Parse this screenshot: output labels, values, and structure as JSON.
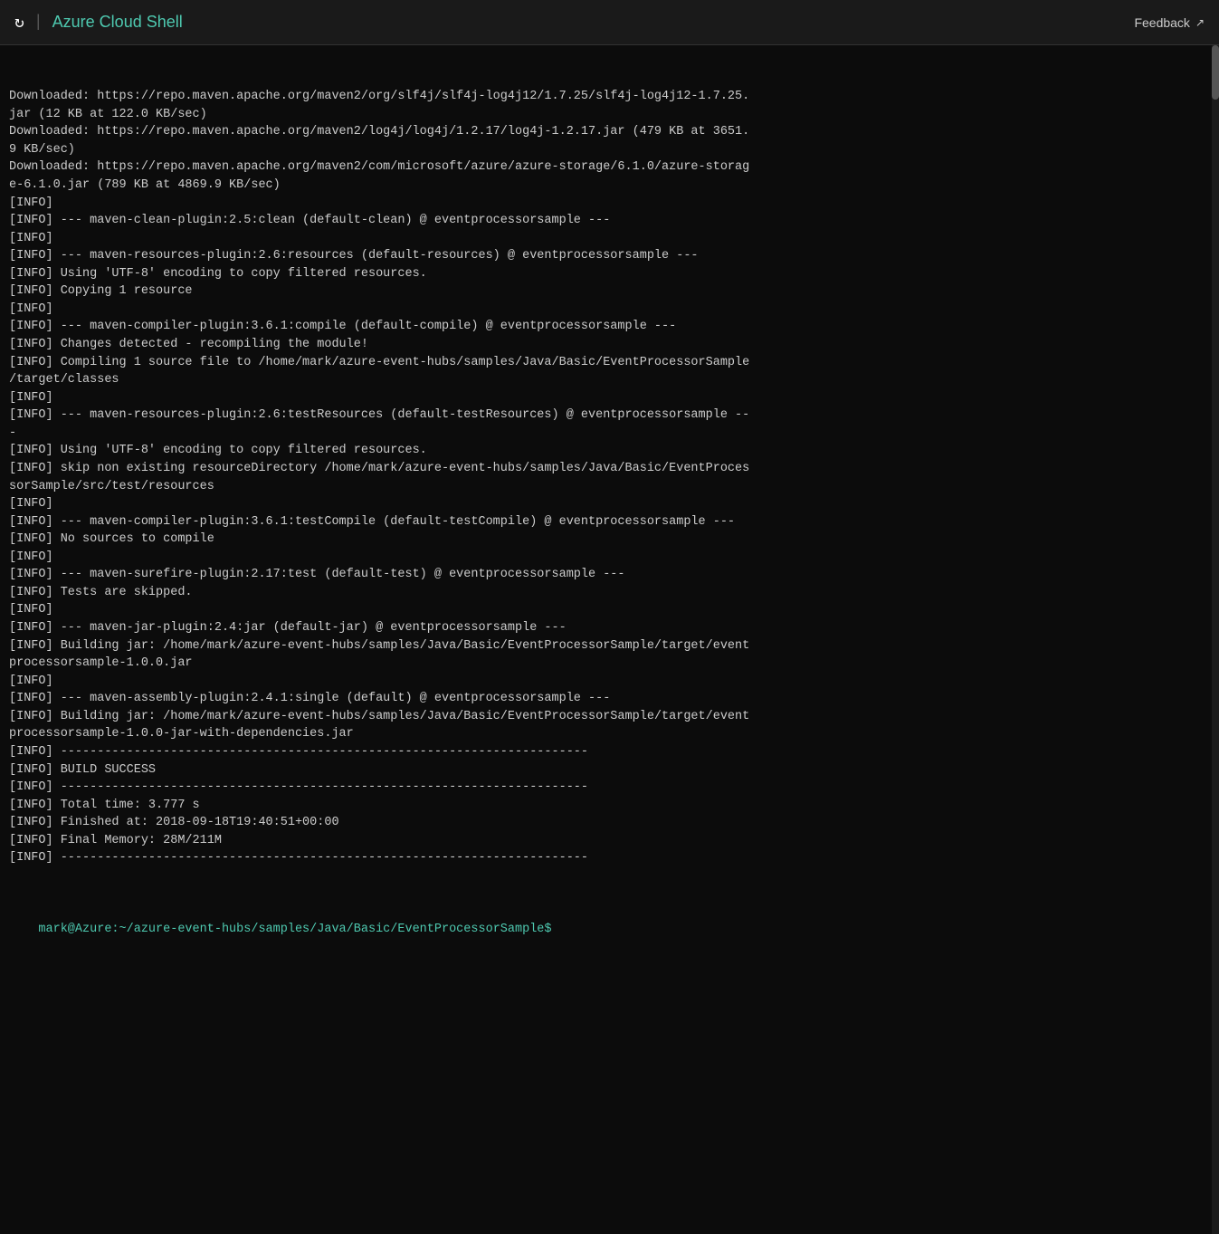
{
  "titleBar": {
    "appName": "Azure Cloud Shell",
    "feedbackLabel": "Feedback",
    "refreshIcon": "↻",
    "divider": "|",
    "externalLinkIcon": "↗"
  },
  "terminal": {
    "lines": [
      "Downloaded: https://repo.maven.apache.org/maven2/org/slf4j/slf4j-log4j12/1.7.25/slf4j-log4j12-1.7.25.",
      "jar (12 KB at 122.0 KB/sec)",
      "Downloaded: https://repo.maven.apache.org/maven2/log4j/log4j/1.2.17/log4j-1.2.17.jar (479 KB at 3651.",
      "9 KB/sec)",
      "Downloaded: https://repo.maven.apache.org/maven2/com/microsoft/azure/azure-storage/6.1.0/azure-storag",
      "e-6.1.0.jar (789 KB at 4869.9 KB/sec)",
      "[INFO]",
      "[INFO] --- maven-clean-plugin:2.5:clean (default-clean) @ eventprocessorsample ---",
      "[INFO]",
      "[INFO] --- maven-resources-plugin:2.6:resources (default-resources) @ eventprocessorsample ---",
      "[INFO] Using 'UTF-8' encoding to copy filtered resources.",
      "[INFO] Copying 1 resource",
      "[INFO]",
      "[INFO] --- maven-compiler-plugin:3.6.1:compile (default-compile) @ eventprocessorsample ---",
      "[INFO] Changes detected - recompiling the module!",
      "[INFO] Compiling 1 source file to /home/mark/azure-event-hubs/samples/Java/Basic/EventProcessorSample",
      "/target/classes",
      "[INFO]",
      "[INFO] --- maven-resources-plugin:2.6:testResources (default-testResources) @ eventprocessorsample --",
      "-",
      "[INFO] Using 'UTF-8' encoding to copy filtered resources.",
      "[INFO] skip non existing resourceDirectory /home/mark/azure-event-hubs/samples/Java/Basic/EventProces",
      "sorSample/src/test/resources",
      "[INFO]",
      "[INFO] --- maven-compiler-plugin:3.6.1:testCompile (default-testCompile) @ eventprocessorsample ---",
      "[INFO] No sources to compile",
      "[INFO]",
      "[INFO] --- maven-surefire-plugin:2.17:test (default-test) @ eventprocessorsample ---",
      "[INFO] Tests are skipped.",
      "[INFO]",
      "[INFO] --- maven-jar-plugin:2.4:jar (default-jar) @ eventprocessorsample ---",
      "[INFO] Building jar: /home/mark/azure-event-hubs/samples/Java/Basic/EventProcessorSample/target/event",
      "processorsample-1.0.0.jar",
      "[INFO]",
      "[INFO] --- maven-assembly-plugin:2.4.1:single (default) @ eventprocessorsample ---",
      "[INFO] Building jar: /home/mark/azure-event-hubs/samples/Java/Basic/EventProcessorSample/target/event",
      "processorsample-1.0.0-jar-with-dependencies.jar",
      "[INFO] ------------------------------------------------------------------------",
      "[INFO] BUILD SUCCESS",
      "[INFO] ------------------------------------------------------------------------",
      "[INFO] Total time: 3.777 s",
      "[INFO] Finished at: 2018-09-18T19:40:51+00:00",
      "[INFO] Final Memory: 28M/211M",
      "[INFO] ------------------------------------------------------------------------"
    ],
    "promptLine": "mark@Azure:~/azure-event-hubs/samples/Java/Basic/EventProcessorSample$",
    "promptSuffix": " "
  }
}
